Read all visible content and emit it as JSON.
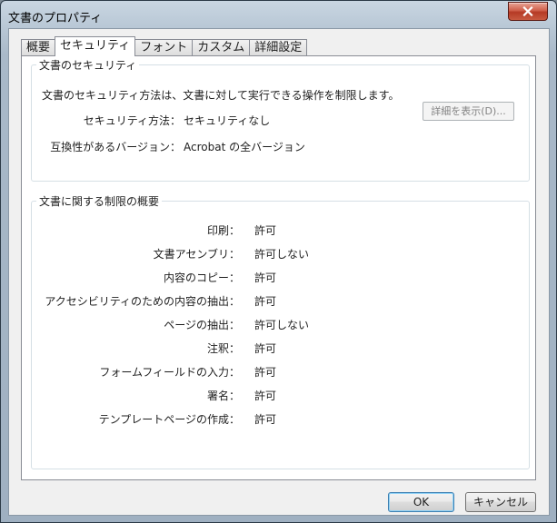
{
  "window": {
    "title": "文書のプロパティ"
  },
  "tabs": [
    {
      "label": "概要",
      "active": false
    },
    {
      "label": "セキュリティ",
      "active": true
    },
    {
      "label": "フォント",
      "active": false
    },
    {
      "label": "カスタム",
      "active": false
    },
    {
      "label": "詳細設定",
      "active": false
    }
  ],
  "security": {
    "legend": "文書のセキュリティ",
    "description": "文書のセキュリティ方法は、文書に対して実行できる操作を制限します。",
    "method_label": "セキュリティ方法：",
    "method_value": "セキュリティなし",
    "detail_button": "詳細を表示(D)...",
    "compat_label": "互換性があるバージョン：",
    "compat_value": "Acrobat の全バージョン"
  },
  "restrictions": {
    "legend": "文書に関する制限の概要",
    "rows": [
      {
        "label": "印刷：",
        "value": "許可"
      },
      {
        "label": "文書アセンブリ：",
        "value": "許可しない"
      },
      {
        "label": "内容のコピー：",
        "value": "許可"
      },
      {
        "label": "アクセシビリティのための内容の抽出：",
        "value": "許可"
      },
      {
        "label": "ページの抽出：",
        "value": "許可しない"
      },
      {
        "label": "注釈：",
        "value": "許可"
      },
      {
        "label": "フォームフィールドの入力：",
        "value": "許可"
      },
      {
        "label": "署名：",
        "value": "許可"
      },
      {
        "label": "テンプレートページの作成：",
        "value": "許可"
      }
    ]
  },
  "buttons": {
    "ok": "OK",
    "cancel": "キャンセル"
  },
  "icons": {
    "close": "close-icon"
  },
  "colors": {
    "close_button": "#c85a40",
    "ok_focus": "#3c7fb1"
  }
}
